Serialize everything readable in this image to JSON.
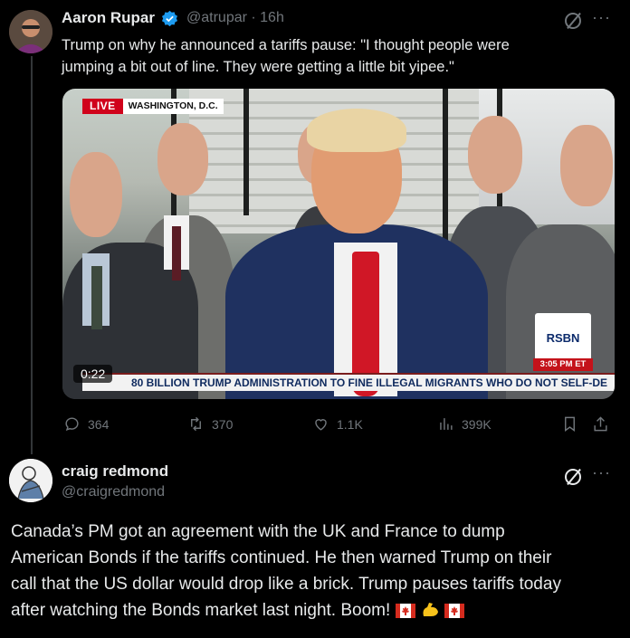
{
  "tweet": {
    "author": "Aaron Rupar",
    "handle": "@atrupar",
    "time": "16h",
    "text_line1": "Trump on why he announced a tariffs pause: \"I thought people were",
    "text_line2": "jumping a bit out of line. They were getting a little bit yipee.\"",
    "video": {
      "live": "LIVE",
      "location": "WASHINGTON, D.C.",
      "duration": "0:22",
      "ticker": "80 BILLION    TRUMP ADMINISTRATION TO FINE ILLEGAL MIGRANTS WHO DO NOT SELF-DE",
      "channel_logo": "RSBN",
      "channel_time": "3:05 PM ET"
    },
    "stats": {
      "replies": "364",
      "reposts": "370",
      "likes": "1.1K",
      "views": "399K"
    }
  },
  "reply": {
    "author": "craig redmond",
    "handle": "@craigredmond",
    "text_line1": "Canada’s PM got an agreement with the UK and France to dump",
    "text_line2": "American Bonds if the tariffs continued. He then warned Trump on their",
    "text_line3": "call that the US dollar would drop like a brick. Trump pauses tariffs today",
    "text_line4": "after watching the Bonds market last night. Boom!"
  },
  "colors": {
    "background": "#000000",
    "text": "#e7e9ea",
    "secondary": "#71767b",
    "verified": "#1d9bf0"
  }
}
